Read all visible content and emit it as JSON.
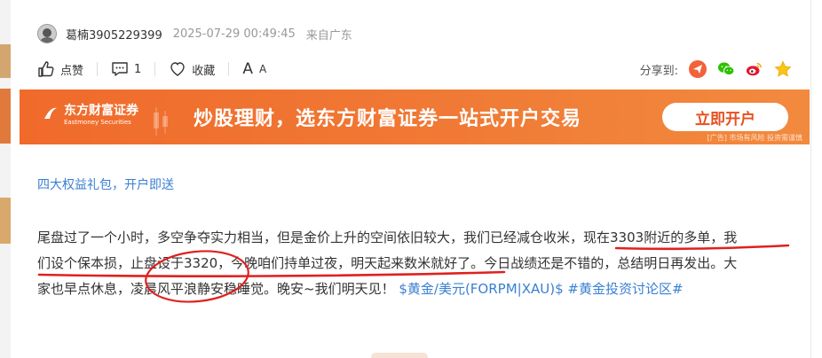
{
  "post": {
    "author": "葛楠3905229399",
    "time": "2025-07-29 00:49:45",
    "location": "来自广东"
  },
  "actions": {
    "like_label": "点赞",
    "comment_count": "1",
    "favorite_label": "收藏",
    "font_big": "A",
    "font_small": "A",
    "share_label": "分享到:"
  },
  "ad": {
    "brand_cn": "东方财富证券",
    "brand_en": "Eastmoney Securities",
    "slogan": "炒股理财，选东方财富证券一站式开户交易",
    "cta": "立即开户",
    "tag": "[广告] 市场有风险 投资需谨慎"
  },
  "gift_link": "四大权益礼包，开户即送",
  "content": {
    "line1_a": "尾盘过了一个小时，多空争夺实力相当，但是金价上升的空间依旧较大，我们已经减仓收米，",
    "line1_b": "现在3303附近的多单，我",
    "line2_a": "们设个保本损，止盘设于3320，今晚咱们持单过夜，明天起来数米就好了。",
    "line2_b": "今日战绩还是不错的，总结明日再发出。大",
    "line3_a": "家也早点休息，凌晨风平浪静安稳睡觉。晚安~我们明天见！",
    "tag1": "$黄金/美元(FORPM|XAU)$",
    "tag2": "#黄金投资讨论区#"
  },
  "colors": {
    "accent_link": "#3a7fd1",
    "ad_orange": "#f06a2b",
    "annotation_red": "#e02020"
  }
}
